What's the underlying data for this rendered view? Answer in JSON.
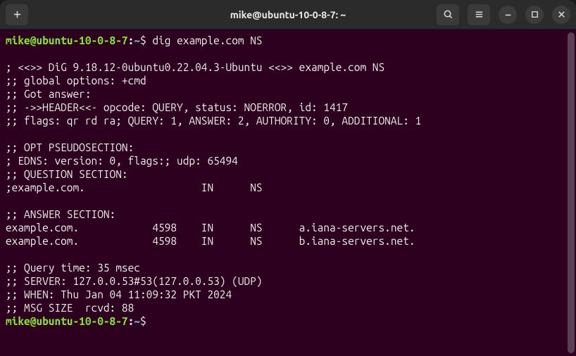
{
  "titlebar": {
    "title": "mike@ubuntu-10-0-8-7: ~"
  },
  "prompt1": {
    "user": "mike@ubuntu-10-0-8-7",
    "colon": ":",
    "path": "~",
    "dollar": "$ ",
    "command": "dig example.com NS"
  },
  "output_lines": [
    "",
    "; <<>> DiG 9.18.12-0ubuntu0.22.04.3-Ubuntu <<>> example.com NS",
    ";; global options: +cmd",
    ";; Got answer:",
    ";; ->>HEADER<<- opcode: QUERY, status: NOERROR, id: 1417",
    ";; flags: qr rd ra; QUERY: 1, ANSWER: 2, AUTHORITY: 0, ADDITIONAL: 1",
    "",
    ";; OPT PSEUDOSECTION:",
    "; EDNS: version: 0, flags:; udp: 65494",
    ";; QUESTION SECTION:",
    ";example.com.                   IN      NS",
    "",
    ";; ANSWER SECTION:",
    "example.com.            4598    IN      NS      a.iana-servers.net.",
    "example.com.            4598    IN      NS      b.iana-servers.net.",
    "",
    ";; Query time: 35 msec",
    ";; SERVER: 127.0.0.53#53(127.0.0.53) (UDP)",
    ";; WHEN: Thu Jan 04 11:09:32 PKT 2024",
    ";; MSG SIZE  rcvd: 88",
    ""
  ],
  "prompt2": {
    "user": "mike@ubuntu-10-0-8-7",
    "colon": ":",
    "path": "~",
    "dollar": "$ "
  }
}
